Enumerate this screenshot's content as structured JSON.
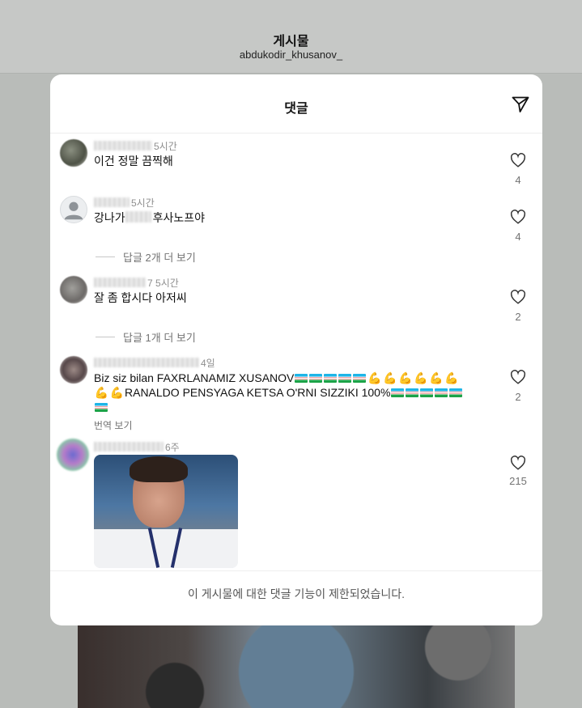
{
  "page": {
    "title": "게시물",
    "username": "abdukodir_khusanov_"
  },
  "sheet": {
    "title": "댓글",
    "share_icon": "send-icon",
    "footer_text": "이 게시물에 대한 댓글 기능이 제한되었습니다."
  },
  "comments": [
    {
      "time": "5시간",
      "text": "이건 정말 끔찍해",
      "likes": "4"
    },
    {
      "time": "5시간",
      "text_before": "강나가",
      "text_after": "후사노프야",
      "likes": "4",
      "replies_label": "답글 2개 더 보기"
    },
    {
      "username_suffix": "7",
      "time": "5시간",
      "text": "잘 좀 합시다 아저씨",
      "likes": "2",
      "replies_label": "답글 1개 더 보기"
    },
    {
      "time": "4일",
      "text_line1": "Biz siz bilan FAXRLANAMIZ  XUSANOV",
      "text_line2": "RANALDO  PENSYAGA KETSA O'RNI SIZZIKI 100%",
      "likes": "2",
      "translate_label": "번역 보기"
    },
    {
      "time": "6주",
      "likes": "215"
    }
  ]
}
